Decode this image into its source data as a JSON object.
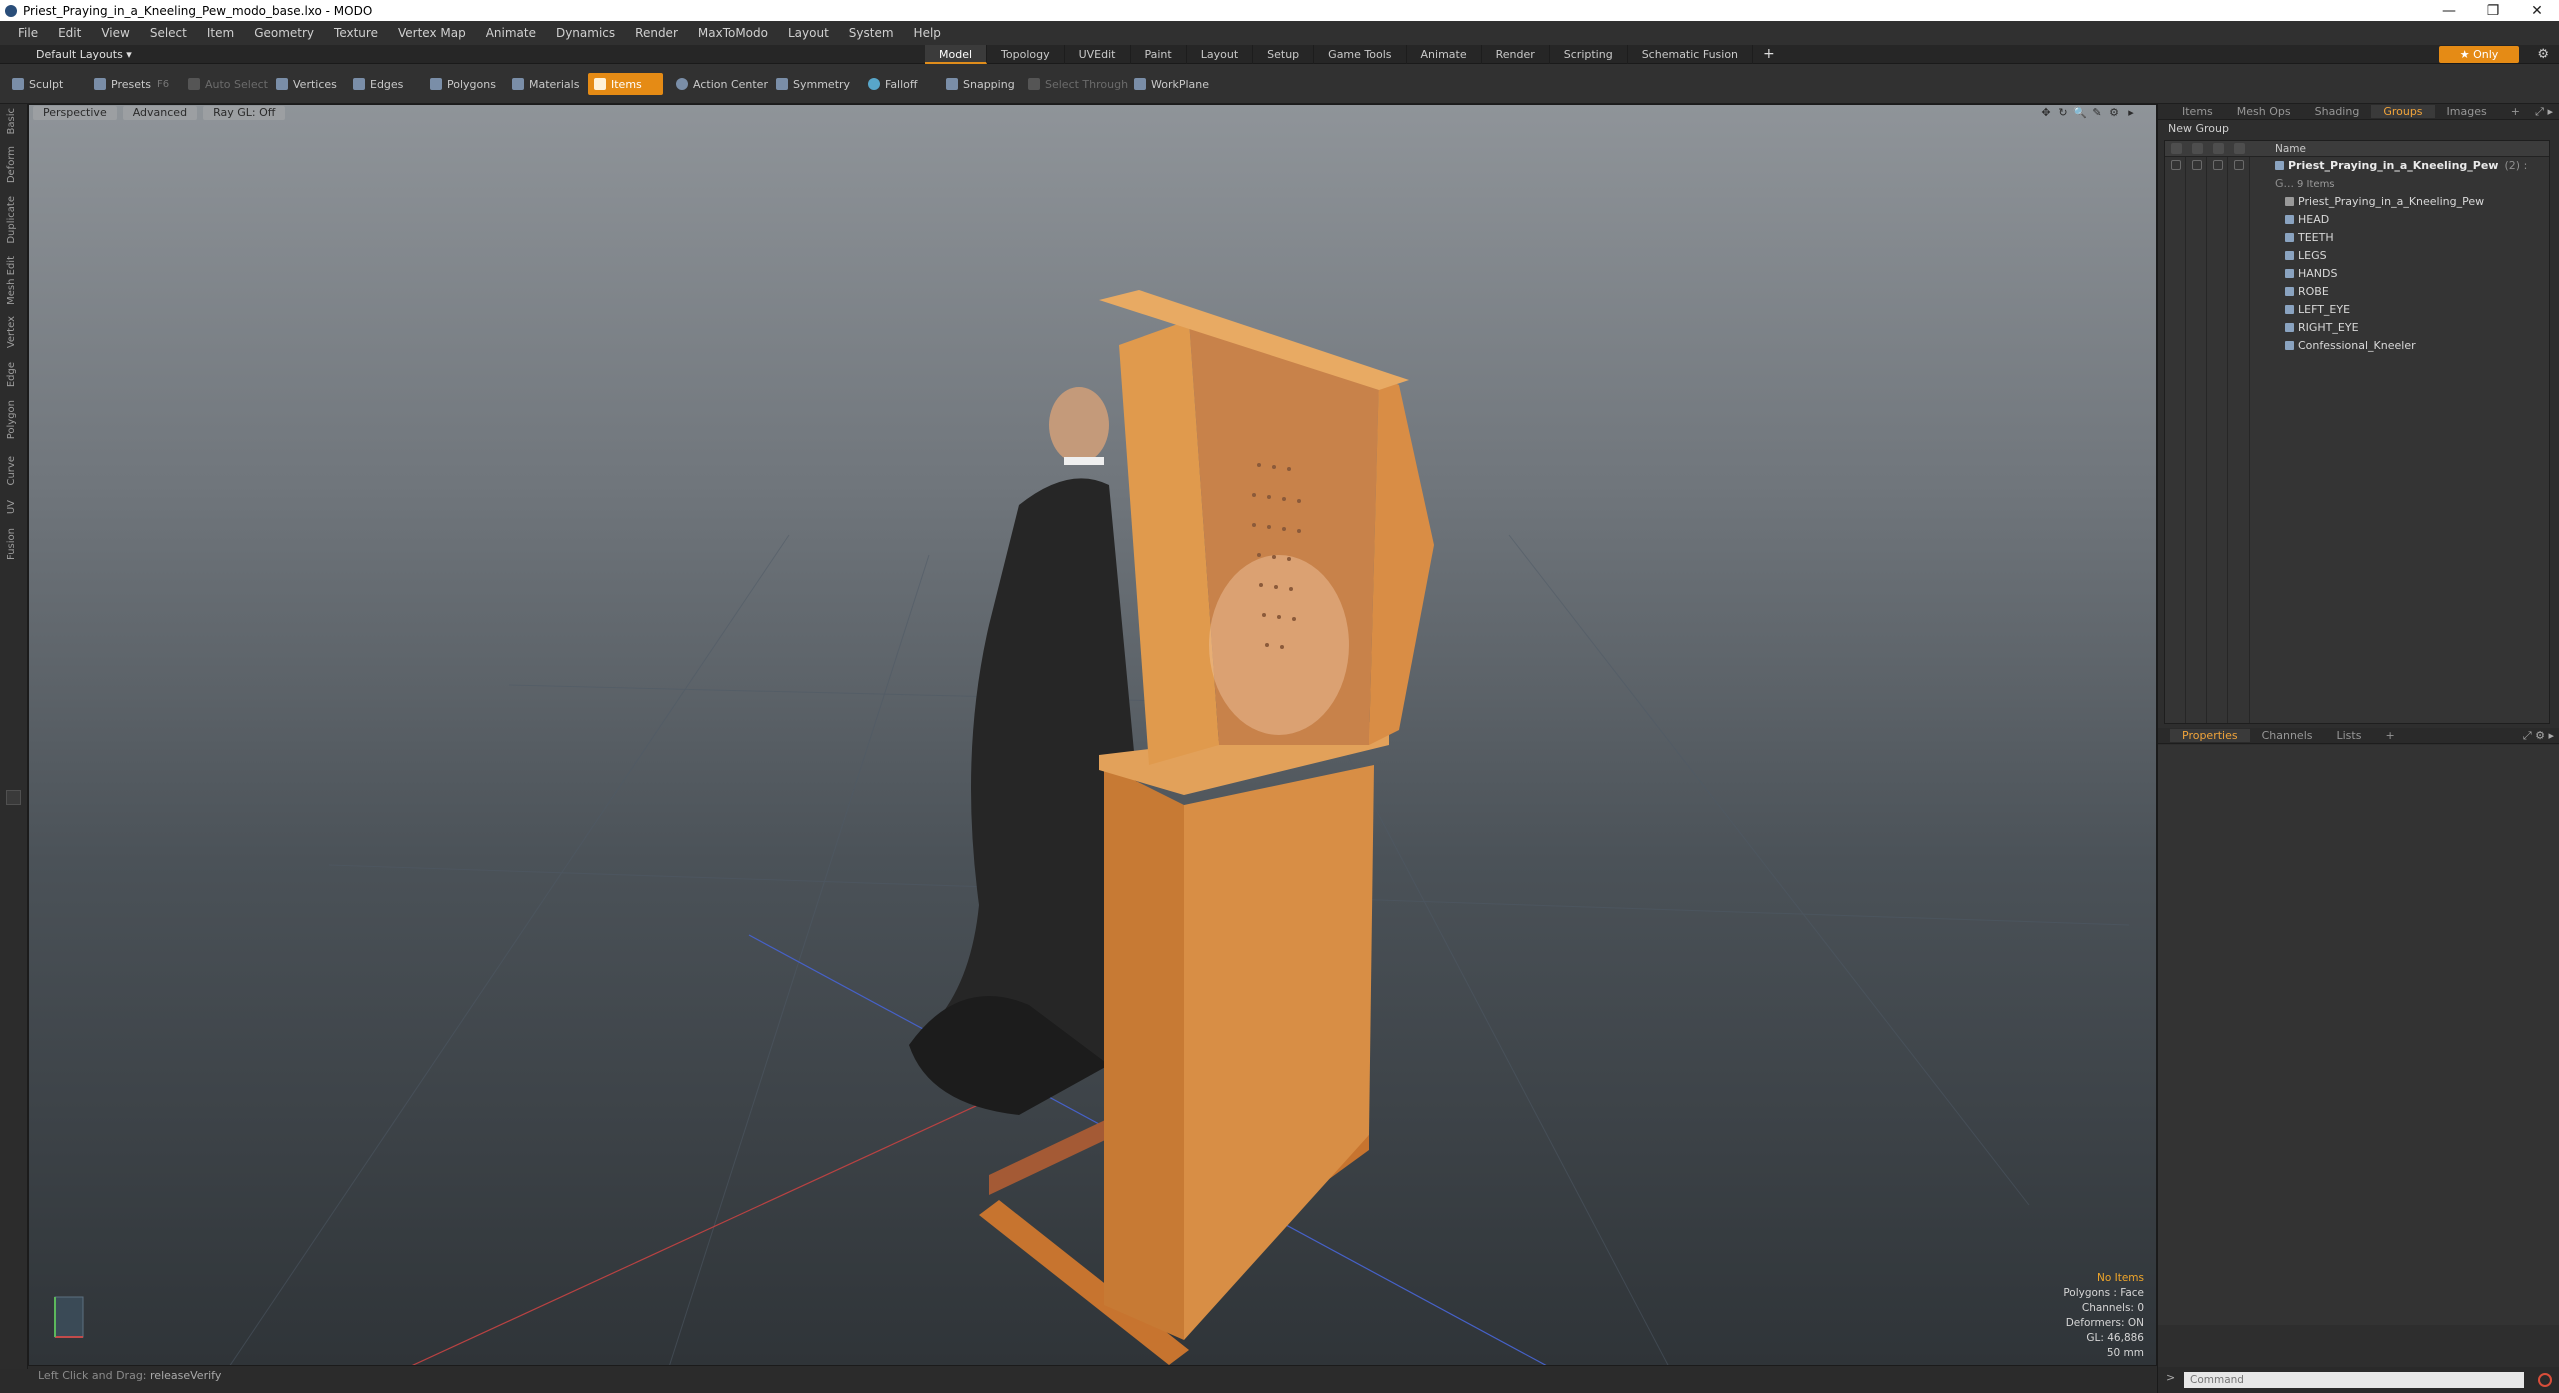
{
  "window": {
    "title": "Priest_Praying_in_a_Kneeling_Pew_modo_base.lxo - MODO",
    "controls": [
      "—",
      "❐",
      "✕"
    ]
  },
  "menu": [
    "File",
    "Edit",
    "View",
    "Select",
    "Item",
    "Geometry",
    "Texture",
    "Vertex Map",
    "Animate",
    "Dynamics",
    "Render",
    "MaxToModo",
    "Layout",
    "System",
    "Help"
  ],
  "layoutbar": {
    "layout_select": "Default Layouts ▾",
    "tabs": [
      "Model",
      "Topology",
      "UVEdit",
      "Paint",
      "Layout",
      "Setup",
      "Game Tools",
      "Animate",
      "Render",
      "Scripting",
      "Schematic Fusion"
    ],
    "active_tab": "Model",
    "add_tab": "+",
    "only_label": "★  Only",
    "gear": "⚙"
  },
  "toolbar": {
    "sculpt": "Sculpt",
    "presets": "Presets",
    "presets_hint": "F6",
    "auto_select": "Auto Select",
    "vertices": "Vertices",
    "edges": "Edges",
    "polygons": "Polygons",
    "materials": "Materials",
    "items": "Items",
    "action_center": "Action Center",
    "symmetry": "Symmetry",
    "falloff": "Falloff",
    "snapping": "Snapping",
    "select_through": "Select Through",
    "workplane": "WorkPlane"
  },
  "leftstrip": [
    "Basic",
    "Deform",
    "Duplicate",
    "Mesh Edit",
    "Vertex",
    "Edge",
    "Polygon",
    "Curve",
    "UV",
    "Fusion"
  ],
  "viewport": {
    "view_mode": "Perspective",
    "shading": "Advanced",
    "raygl": "Ray GL: Off",
    "icons": [
      "✥",
      "↻",
      "🔍",
      "✎",
      "⚙",
      "▸"
    ],
    "info": {
      "selection": "No Items",
      "polygons": "Polygons : Face",
      "channels": "Channels: 0",
      "deformers": "Deformers: ON",
      "gl": "GL: 46,886",
      "focal": "50 mm"
    }
  },
  "status": {
    "key": "Left Click and Drag:",
    "value": "releaseVerify"
  },
  "groups_panel": {
    "tabs": [
      "Items",
      "Mesh Ops",
      "Shading",
      "Groups",
      "Images",
      "+"
    ],
    "active_tab": "Groups",
    "corner": "⤢ ▸",
    "new_group": "New Group",
    "name_header": "Name",
    "root": {
      "name": "Priest_Praying_in_a_Kneeling_Pew",
      "meta": "(2) : G...",
      "count": "9 Items"
    },
    "items": [
      "Priest_Praying_in_a_Kneeling_Pew",
      "HEAD",
      "TEETH",
      "LEGS",
      "HANDS",
      "ROBE",
      "LEFT_EYE",
      "RIGHT_EYE",
      "Confessional_Kneeler"
    ]
  },
  "properties_panel": {
    "tabs": [
      "Properties",
      "Channels",
      "Lists",
      "+"
    ],
    "active_tab": "Properties",
    "corner": "⤢ ⚙ ▸"
  },
  "command": {
    "arrow": ">",
    "placeholder": "Command"
  },
  "colors": {
    "accent": "#e58b15",
    "wood": "#d58a3c",
    "robe": "#2a2a2a"
  }
}
